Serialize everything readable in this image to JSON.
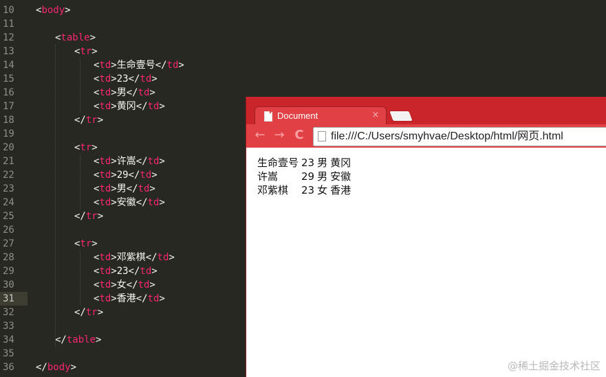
{
  "editor": {
    "lines": [
      {
        "n": "10",
        "indent": "",
        "open": "<",
        "tag": "body",
        "close": ">",
        "text": "",
        "etag": ""
      },
      {
        "n": "11",
        "indent": "",
        "open": "",
        "tag": "",
        "close": "",
        "text": "",
        "etag": ""
      },
      {
        "n": "12",
        "indent": "    ",
        "open": "<",
        "tag": "table",
        "close": ">",
        "text": "",
        "etag": ""
      },
      {
        "n": "13",
        "indent": "        ",
        "open": "<",
        "tag": "tr",
        "close": ">",
        "text": "",
        "etag": ""
      },
      {
        "n": "14",
        "indent": "            ",
        "open": "<",
        "tag": "td",
        "close": ">",
        "text": "生命壹号",
        "etag": "td"
      },
      {
        "n": "15",
        "indent": "            ",
        "open": "<",
        "tag": "td",
        "close": ">",
        "text": "23",
        "etag": "td"
      },
      {
        "n": "16",
        "indent": "            ",
        "open": "<",
        "tag": "td",
        "close": ">",
        "text": "男",
        "etag": "td"
      },
      {
        "n": "17",
        "indent": "            ",
        "open": "<",
        "tag": "td",
        "close": ">",
        "text": "黄冈",
        "etag": "td"
      },
      {
        "n": "18",
        "indent": "        ",
        "open": "</",
        "tag": "tr",
        "close": ">",
        "text": "",
        "etag": ""
      },
      {
        "n": "19",
        "indent": "",
        "open": "",
        "tag": "",
        "close": "",
        "text": "",
        "etag": ""
      },
      {
        "n": "20",
        "indent": "        ",
        "open": "<",
        "tag": "tr",
        "close": ">",
        "text": "",
        "etag": ""
      },
      {
        "n": "21",
        "indent": "            ",
        "open": "<",
        "tag": "td",
        "close": ">",
        "text": "许嵩",
        "etag": "td"
      },
      {
        "n": "22",
        "indent": "            ",
        "open": "<",
        "tag": "td",
        "close": ">",
        "text": "29",
        "etag": "td"
      },
      {
        "n": "23",
        "indent": "            ",
        "open": "<",
        "tag": "td",
        "close": ">",
        "text": "男",
        "etag": "td"
      },
      {
        "n": "24",
        "indent": "            ",
        "open": "<",
        "tag": "td",
        "close": ">",
        "text": "安徽",
        "etag": "td"
      },
      {
        "n": "25",
        "indent": "        ",
        "open": "</",
        "tag": "tr",
        "close": ">",
        "text": "",
        "etag": ""
      },
      {
        "n": "26",
        "indent": "",
        "open": "",
        "tag": "",
        "close": "",
        "text": "",
        "etag": ""
      },
      {
        "n": "27",
        "indent": "        ",
        "open": "<",
        "tag": "tr",
        "close": ">",
        "text": "",
        "etag": ""
      },
      {
        "n": "28",
        "indent": "            ",
        "open": "<",
        "tag": "td",
        "close": ">",
        "text": "邓紫棋",
        "etag": "td"
      },
      {
        "n": "29",
        "indent": "            ",
        "open": "<",
        "tag": "td",
        "close": ">",
        "text": "23",
        "etag": "td"
      },
      {
        "n": "30",
        "indent": "            ",
        "open": "<",
        "tag": "td",
        "close": ">",
        "text": "女",
        "etag": "td"
      },
      {
        "n": "31",
        "indent": "            ",
        "open": "<",
        "tag": "td",
        "close": ">",
        "text": "香港",
        "etag": "td"
      },
      {
        "n": "32",
        "indent": "        ",
        "open": "</",
        "tag": "tr",
        "close": ">",
        "text": "",
        "etag": ""
      },
      {
        "n": "33",
        "indent": "",
        "open": "",
        "tag": "",
        "close": "",
        "text": "",
        "etag": ""
      },
      {
        "n": "34",
        "indent": "    ",
        "open": "</",
        "tag": "table",
        "close": ">",
        "text": "",
        "etag": ""
      },
      {
        "n": "35",
        "indent": "",
        "open": "",
        "tag": "",
        "close": "",
        "text": "",
        "etag": ""
      },
      {
        "n": "36",
        "indent": "",
        "open": "</",
        "tag": "body",
        "close": ">",
        "text": "",
        "etag": ""
      }
    ],
    "current_line": "31"
  },
  "browser": {
    "tab_title": "Document",
    "tab_close": "×",
    "back": "←",
    "forward": "→",
    "reload": "C",
    "url": "file:///C:/Users/smyhvae/Desktop/html/网页.html",
    "table_rows": [
      [
        "生命壹号",
        "23",
        "男",
        "黄冈"
      ],
      [
        "许嵩",
        "29",
        "男",
        "安徽"
      ],
      [
        "邓紫棋",
        "23",
        "女",
        "香港"
      ]
    ]
  },
  "watermark": "@稀土掘金技术社区",
  "colors": {
    "editor_bg": "#272822",
    "tag": "#f92672",
    "text": "#f8f8f2",
    "line_number": "#8f908a",
    "browser_frame": "#c9252b"
  }
}
